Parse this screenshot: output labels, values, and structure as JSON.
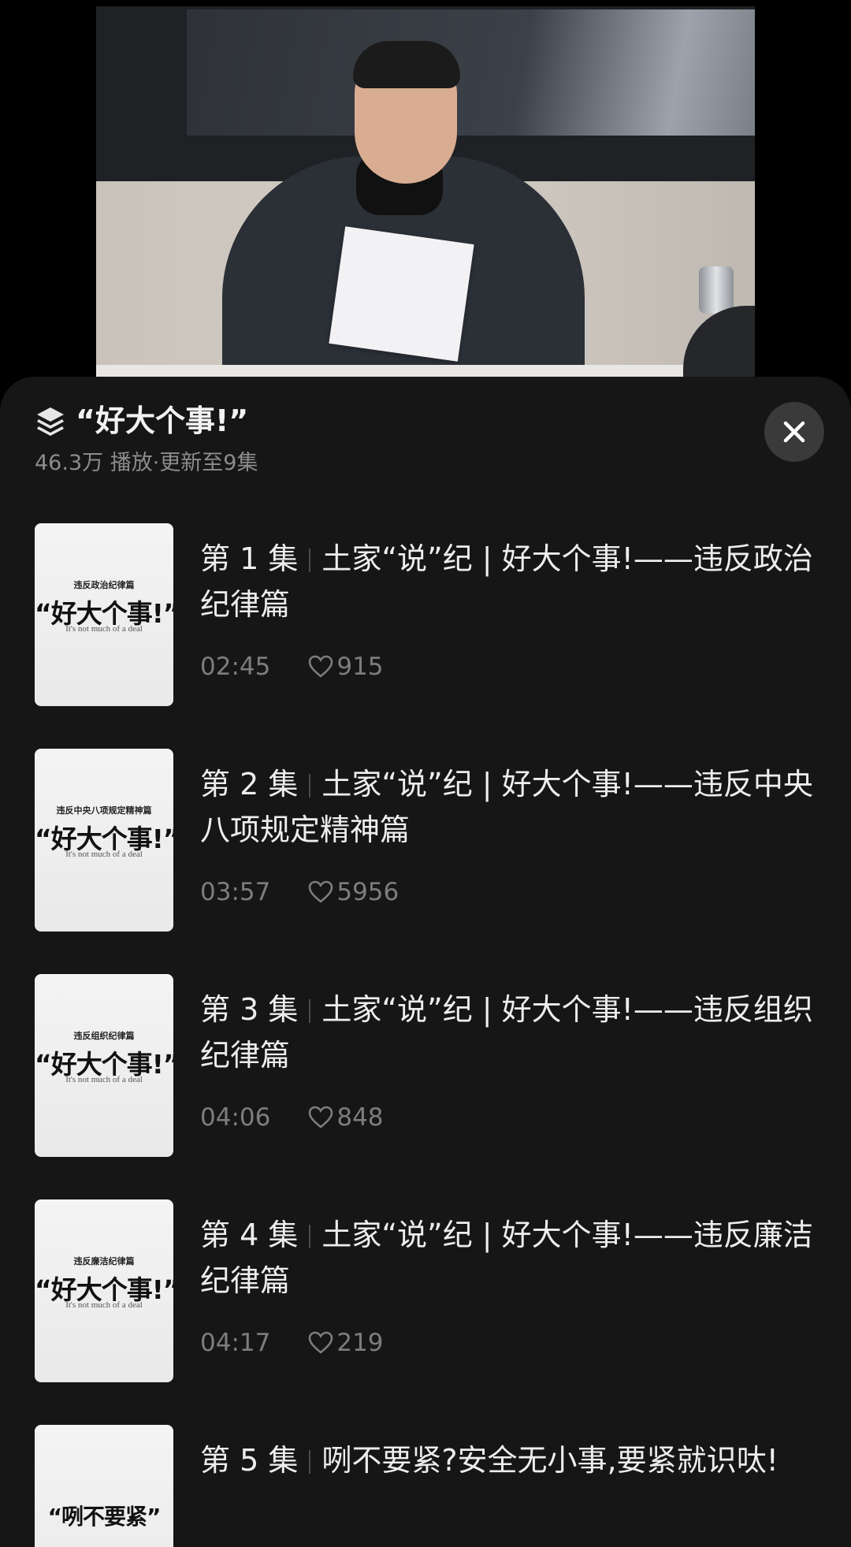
{
  "playlist": {
    "title": "“好大个事!”",
    "plays": "46.3万",
    "play_suffix": "播放",
    "update": "更新至9集",
    "icon": "layers-icon",
    "close_icon": "close-icon"
  },
  "episodes": [
    {
      "num": "第 1 集",
      "title": "土家“说”纪 | 好大个事!——违反政治纪律篇",
      "duration": "02:45",
      "likes": "915",
      "thumb_sub": "违反政治纪律篇",
      "thumb_main": "“好大个事!”",
      "thumb_en": "It's not much of a deal"
    },
    {
      "num": "第 2 集",
      "title": "土家“说”纪 | 好大个事!——违反中央八项规定精神篇",
      "duration": "03:57",
      "likes": "5956",
      "thumb_sub": "违反中央八项规定精神篇",
      "thumb_main": "“好大个事!”",
      "thumb_en": "It's not much of a deal"
    },
    {
      "num": "第 3 集",
      "title": "土家“说”纪 | 好大个事!——违反组织纪律篇",
      "duration": "04:06",
      "likes": "848",
      "thumb_sub": "违反组织纪律篇",
      "thumb_main": "“好大个事!”",
      "thumb_en": "It's not much of a deal"
    },
    {
      "num": "第 4 集",
      "title": "土家“说”纪 | 好大个事!——违反廉洁纪律篇",
      "duration": "04:17",
      "likes": "219",
      "thumb_sub": "违反廉洁纪律篇",
      "thumb_main": "“好大个事!”",
      "thumb_en": "It's not much of a deal"
    },
    {
      "num": "第 5 集",
      "title": "咧不要紧?安全无小事,要紧就识呔!",
      "thumb_main": "“咧不要紧”"
    }
  ],
  "colors": {
    "sheet_bg": "#161616",
    "text_primary": "#ededed",
    "text_secondary": "#7d7d7d",
    "close_bg": "#3a3a3a"
  }
}
